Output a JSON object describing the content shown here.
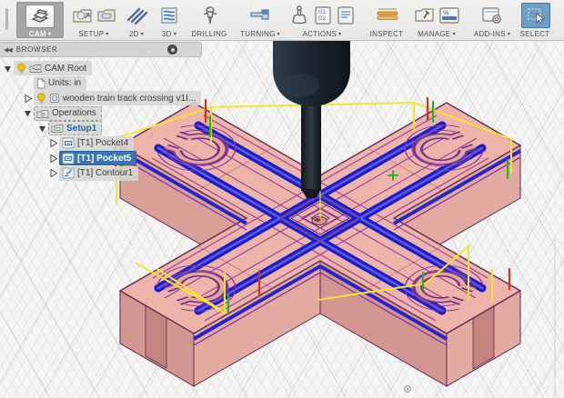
{
  "app": {
    "name": "Fusion 360 CAM workspace"
  },
  "toolbar": {
    "groups": [
      {
        "id": "cam",
        "label": "CAM",
        "caret": "▾",
        "icons": [
          "cam-workspace-icon"
        ]
      },
      {
        "id": "setup",
        "label": "SETUP",
        "caret": "▾",
        "icons": [
          "new-setup-icon",
          "setup-folder-icon"
        ]
      },
      {
        "id": "2d",
        "label": "2D",
        "caret": "▾",
        "icons": [
          "2d-milling-icon"
        ]
      },
      {
        "id": "3d",
        "label": "3D",
        "caret": "▾",
        "icons": [
          "3d-milling-icon"
        ]
      },
      {
        "id": "drilling",
        "label": "DRILLING",
        "caret": "",
        "icons": [
          "drill-icon"
        ]
      },
      {
        "id": "turning",
        "label": "TURNING",
        "caret": "▾",
        "icons": [
          "lathe-icon"
        ]
      },
      {
        "id": "actions",
        "label": "ACTIONS",
        "caret": "▾",
        "icons": [
          "simulate-icon",
          "post-process-icon",
          "setup-sheet-icon"
        ]
      },
      {
        "id": "inspect",
        "label": "INSPECT",
        "caret": "",
        "icons": [
          "measure-icon"
        ]
      },
      {
        "id": "manage",
        "label": "MANAGE",
        "caret": "▾",
        "icons": [
          "tool-library-icon",
          "feeds-speeds-icon"
        ]
      },
      {
        "id": "addins",
        "label": "ADD-INS",
        "caret": "▾",
        "icons": [
          "addins-icon"
        ]
      },
      {
        "id": "select",
        "label": "SELECT",
        "caret": "",
        "icons": [
          "select-cursor-icon"
        ],
        "active": true
      }
    ]
  },
  "browser": {
    "title": "BROWSER",
    "collapse_icon": "◀◀",
    "tree": [
      {
        "label": "CAM Root",
        "icons": [
          "lightbulb-icon",
          "cam-root-icon"
        ],
        "expanded": true
      },
      {
        "label": "Units: in",
        "icons": [
          "document-icon"
        ]
      },
      {
        "label": "wooden train track crossing v1I...",
        "icons": [
          "lightbulb-icon",
          "component-icon"
        ],
        "expanded": false
      },
      {
        "label": "Operations",
        "icons": [
          "operations-folder-icon"
        ],
        "expanded": true,
        "dashed": true
      },
      {
        "label": "Setup1",
        "icons": [
          "setup-icon"
        ],
        "expanded": true,
        "dashed": true,
        "text_color": "#1a66b8"
      },
      {
        "label": "[T1] Pocket4",
        "icons": [
          "pocket-operation-icon"
        ],
        "expanded": false
      },
      {
        "label": "[T1] Pocket5",
        "icons": [
          "pocket-operation-icon"
        ],
        "selected": true
      },
      {
        "label": "[T1] Contour1",
        "icons": [
          "contour-operation-icon"
        ],
        "expanded": false
      }
    ]
  },
  "canvas": {
    "view": "isometric",
    "model": "wooden train track crossing (X-shaped part) with CAM toolpaths and cutting tool",
    "colors": {
      "selection_blue": "#3a74b8",
      "setup_text_blue": "#1a66b8",
      "part_top_pink": "#eeb4aa",
      "part_side_pink": "#d89c93",
      "toolpath_blue": "#1d1dc4",
      "toolpath_purple": "#8a3a9c",
      "rapid_yellow": "#f2e437",
      "plunge_red": "#d23420",
      "lead_green": "#25b425",
      "tool_holder_dark": "#1e2933",
      "inspect_orange": "#e8a33d",
      "select_active": "#6d9fc4"
    }
  }
}
